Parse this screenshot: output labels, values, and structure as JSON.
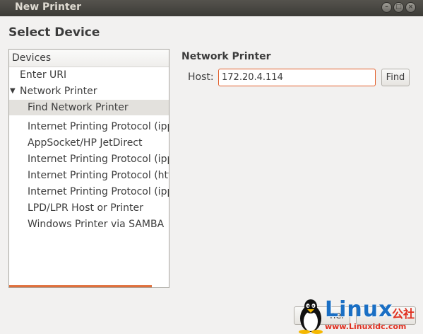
{
  "window": {
    "title": "New Printer"
  },
  "heading": "Select Device",
  "devices": {
    "header": "Devices",
    "items": [
      {
        "label": "Enter URI"
      },
      {
        "label": "Network Printer",
        "expanded": true
      },
      {
        "label": "Find Network Printer",
        "selected": true
      },
      {
        "label": "Internet Printing Protocol (ipp"
      },
      {
        "label": "AppSocket/HP JetDirect"
      },
      {
        "label": "Internet Printing Protocol (ipp"
      },
      {
        "label": "Internet Printing Protocol (htt"
      },
      {
        "label": "Internet Printing Protocol (ipp"
      },
      {
        "label": "LPD/LPR Host or Printer"
      },
      {
        "label": "Windows Printer via SAMBA"
      }
    ]
  },
  "network_printer": {
    "title": "Network Printer",
    "host_label": "Host:",
    "host_value": "172.20.4.114",
    "find_label": "Find"
  },
  "footer": {
    "cancel_partial": "nel"
  },
  "watermark": {
    "brand": "Linux",
    "cn": "公社",
    "url": "www.Linuxidc.com"
  },
  "colors": {
    "titlebar": "#3c3b37",
    "accent": "#e25f2b",
    "background": "#f2f1f0"
  }
}
